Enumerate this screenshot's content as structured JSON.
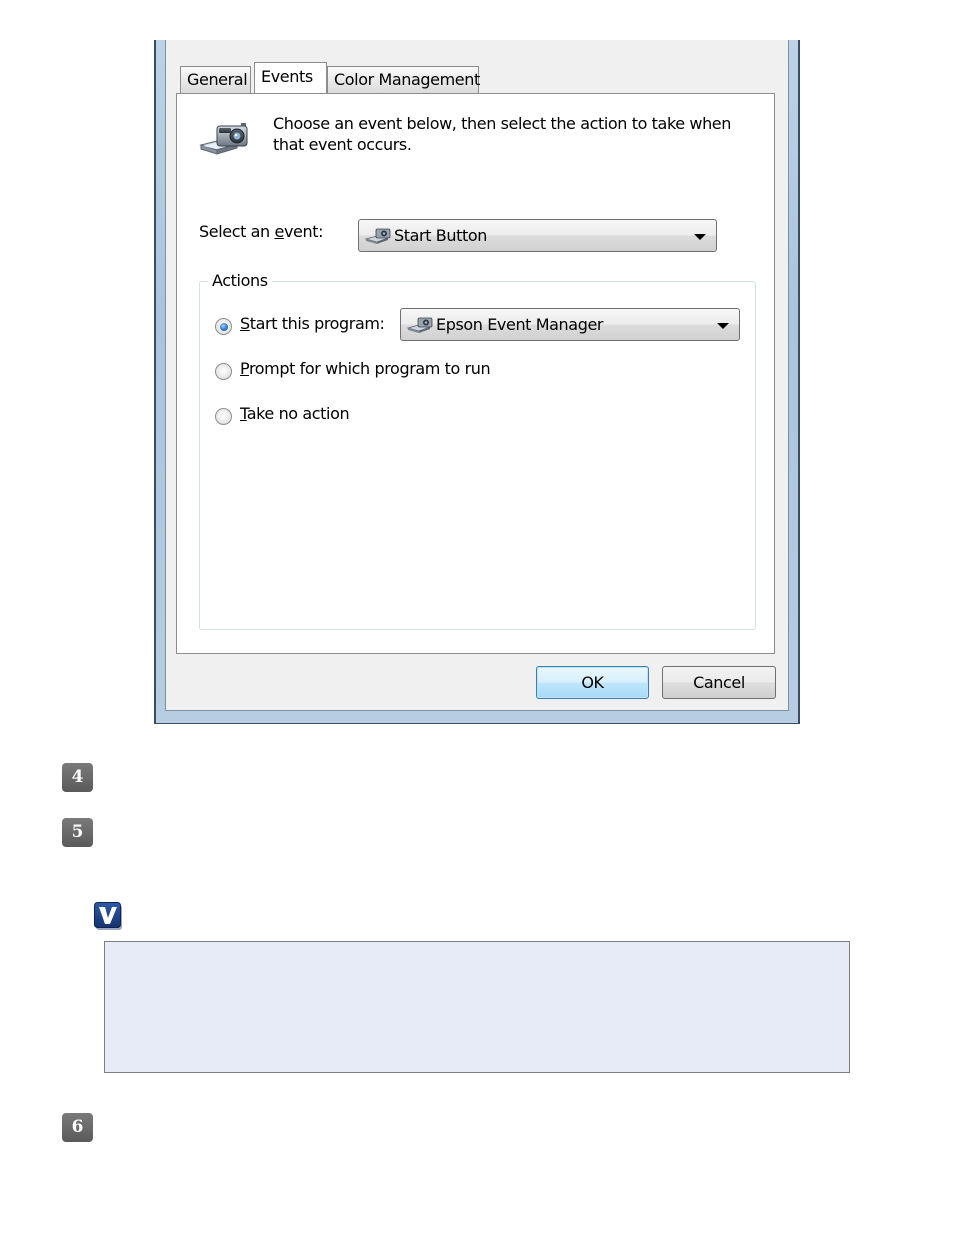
{
  "dialog": {
    "tabs": [
      {
        "label": "General"
      },
      {
        "label": "Events"
      },
      {
        "label": "Color Management"
      }
    ],
    "description": "Choose an event below, then select the action to take when that event occurs.",
    "event_label_pre": "Select an ",
    "event_label_ul": "e",
    "event_label_post": "vent:",
    "event_value": "Start Button",
    "actions_title": "Actions",
    "radio_start": {
      "ul": "S",
      "rest": "tart this program:",
      "checked": true
    },
    "program_value": "Epson Event Manager",
    "radio_prompt": {
      "ul": "P",
      "rest": "rompt for which program to run",
      "checked": false
    },
    "radio_none": {
      "ul": "T",
      "rest": "ake no action",
      "checked": false
    },
    "ok_label": "OK",
    "cancel_label": "Cancel"
  },
  "steps": [
    "4",
    "5",
    "6"
  ],
  "note": {
    "icon": "check-note-icon",
    "text": ""
  },
  "colors": {
    "note_bg": "#e7ebf7",
    "ok_border": "#3c7fb1",
    "frame": "#a9c4dc"
  }
}
